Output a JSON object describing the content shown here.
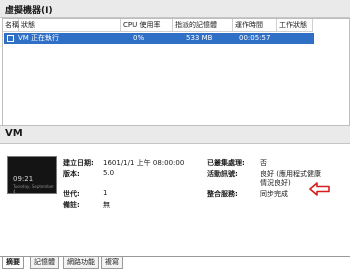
{
  "top_panel": {
    "title": "虛擬機器(I)"
  },
  "vm_list": {
    "columns": [
      "名稱",
      "狀態",
      "CPU 使用率",
      "指派的記憶體",
      "運作時間",
      "工作狀態"
    ],
    "rows": [
      {
        "name": "VM",
        "state": "正在執行",
        "cpu": "0%",
        "memory": "533 MB",
        "uptime": "00:05:57",
        "task": ""
      }
    ]
  },
  "details": {
    "title": "VM",
    "thumbnail": {
      "time": "09:21",
      "caption": "Tuesday, September 4"
    },
    "created_label": "建立日期:",
    "created_value": "1601/1/1 上午 08:00:00",
    "version_label": "版本:",
    "version_value": "5.0",
    "generation_label": "世代:",
    "generation_value": "1",
    "notes_label": "備註:",
    "notes_value": "無",
    "clustered_label": "已叢集處理:",
    "clustered_value": "否",
    "heartbeat_label": "活動訊號:",
    "heartbeat_value_line1": "良好 (應用程式健康",
    "heartbeat_value_line2": "情況良好)",
    "integration_label": "整合服務:",
    "integration_value": "同步完成"
  },
  "tabs": [
    "摘要",
    "記憶體",
    "網路功能",
    "複寫"
  ],
  "colors": {
    "selection": "#2f6fc5",
    "arrow": "#d61f1f"
  }
}
